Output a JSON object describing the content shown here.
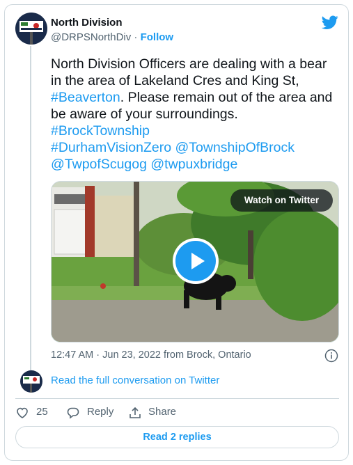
{
  "author": {
    "name": "North Division",
    "handle": "@DRPSNorthDiv",
    "separator": "·",
    "follow_label": "Follow"
  },
  "tweet": {
    "lines": [
      "North Division Officers are dealing with a bear",
      "in the area of Lakeland Cres and King St,"
    ],
    "hashtag_beaverton": "#Beaverton",
    "line3_rest": ". Please remain out of the area and",
    "line4": "be aware of your surroundings.",
    "hashtag_brock": "#BrockTownship",
    "hashtag_durham": "#DurhamVisionZero",
    "mention_township": "@TownshipOfBrock",
    "mention_scugog": "@TwpofScugog",
    "mention_uxbridge": "@twpuxbridge"
  },
  "media": {
    "watch_label": "Watch on Twitter"
  },
  "meta": {
    "timestamp": "12:47 AM · Jun 23, 2022 from Brock, Ontario"
  },
  "conversation": {
    "read_label": "Read the full conversation on Twitter"
  },
  "actions": {
    "like_count": "25",
    "reply_label": "Reply",
    "share_label": "Share"
  },
  "replies_button": "Read 2 replies",
  "colors": {
    "accent": "#1d9bf0",
    "text": "#0f1419",
    "muted": "#536471",
    "border": "#cfd9de"
  },
  "icons": [
    "twitter-bird-icon",
    "play-icon",
    "info-icon",
    "heart-icon",
    "reply-icon",
    "share-icon"
  ]
}
